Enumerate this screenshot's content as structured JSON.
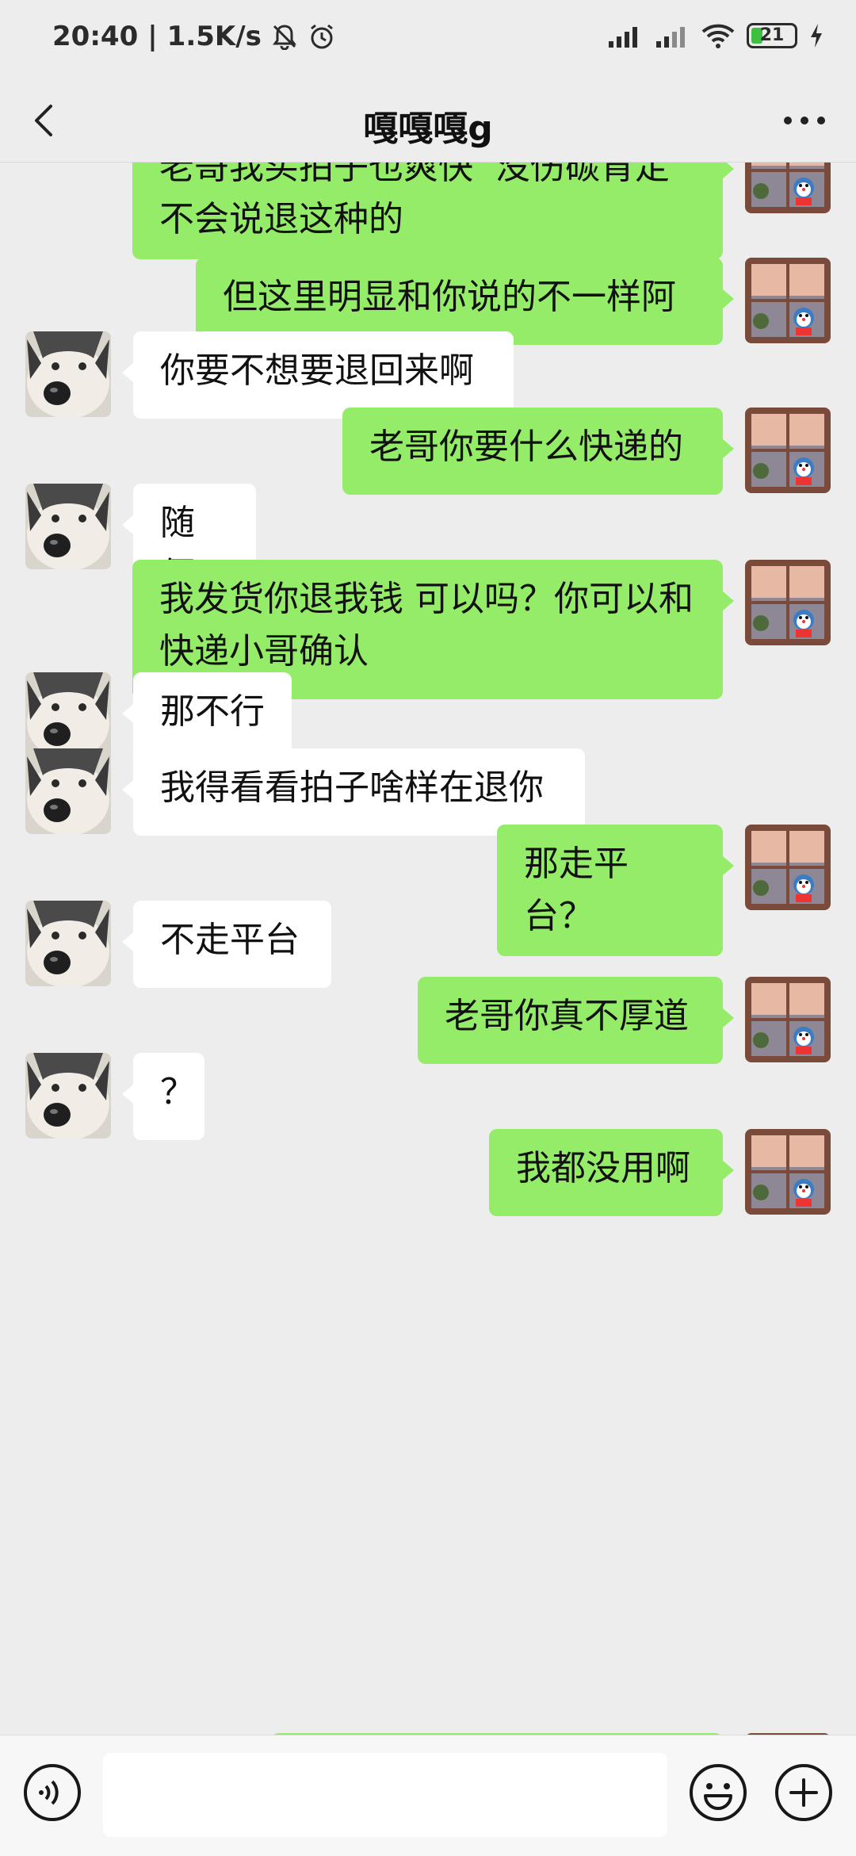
{
  "status_bar": {
    "time": "20:40",
    "net_speed": "1.5K/s",
    "battery": "21"
  },
  "header": {
    "title": "嘎嘎嘎g"
  },
  "messages": [
    {
      "side": "right",
      "text": "老哥我买拍子也爽快  没伤碳肯定不会说退这种的"
    },
    {
      "side": "right",
      "text": "但这里明显和你说的不一样阿"
    },
    {
      "side": "left",
      "text": "你要不想要退回来啊"
    },
    {
      "side": "right",
      "text": "老哥你要什么快递的"
    },
    {
      "side": "left",
      "text": "随便"
    },
    {
      "side": "right",
      "text": "我发货你退我钱 可以吗？你可以和快递小哥确认"
    },
    {
      "side": "left",
      "text": "那不行"
    },
    {
      "side": "left",
      "text": "我得看看拍子啥样在退你"
    },
    {
      "side": "right",
      "text": "那走平台？"
    },
    {
      "side": "left",
      "text": "不走平台"
    },
    {
      "side": "right",
      "text": "老哥你真不厚道"
    },
    {
      "side": "left",
      "text": "？"
    },
    {
      "side": "right",
      "text": "我都没用啊"
    }
  ],
  "input_bar": {
    "placeholder": ""
  },
  "colors": {
    "background": "#ededed",
    "bubble_self": "#95ec69",
    "bubble_other": "#ffffff"
  },
  "icons": [
    "back-arrow-icon",
    "more-dots-icon",
    "voice-icon",
    "emoji-icon",
    "plus-icon",
    "bell-muted-icon",
    "alarm-icon",
    "signal-icon",
    "wifi-icon",
    "charging-icon"
  ]
}
